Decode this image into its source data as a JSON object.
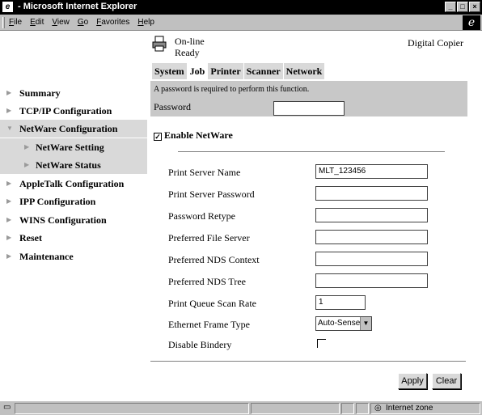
{
  "window": {
    "title": " - Microsoft Internet Explorer",
    "controls": [
      "_",
      "□",
      "×"
    ]
  },
  "menubar": {
    "items": [
      "File",
      "Edit",
      "View",
      "Go",
      "Favorites",
      "Help"
    ]
  },
  "nav": {
    "items": [
      {
        "label": "Summary"
      },
      {
        "label": "TCP/IP Configuration"
      },
      {
        "label": "NetWare Configuration"
      },
      {
        "label": "NetWare Setting"
      },
      {
        "label": "NetWare Status"
      },
      {
        "label": "AppleTalk Configuration"
      },
      {
        "label": "IPP Configuration"
      },
      {
        "label": "WINS Configuration"
      },
      {
        "label": "Reset"
      },
      {
        "label": "Maintenance"
      }
    ]
  },
  "header": {
    "status_line1": "On-line",
    "status_line2": "Ready",
    "device_name": "Digital Copier"
  },
  "tabs": [
    "System",
    "Job",
    "Printer",
    "Scanner",
    "Network"
  ],
  "password": {
    "message": "A password is required to perform this function.",
    "label": "Password",
    "value": ""
  },
  "form": {
    "enable_label": "Enable NetWare",
    "enable_checked": true,
    "fields": [
      {
        "label": "Print Server Name",
        "value": "MLT_123456"
      },
      {
        "label": "Print Server Password",
        "value": ""
      },
      {
        "label": "Password Retype",
        "value": ""
      },
      {
        "label": "Preferred File Server",
        "value": ""
      },
      {
        "label": "Preferred NDS Context",
        "value": ""
      },
      {
        "label": "Preferred NDS Tree",
        "value": ""
      },
      {
        "label": "Print Queue Scan Rate",
        "value": "1"
      }
    ],
    "frame_type": {
      "label": "Ethernet Frame Type",
      "value": "Auto-Sense"
    },
    "disable_bindery": {
      "label": "Disable Bindery",
      "checked": false
    },
    "apply_label": "Apply",
    "clear_label": "Clear"
  },
  "statusbar": {
    "zone": "Internet zone"
  }
}
